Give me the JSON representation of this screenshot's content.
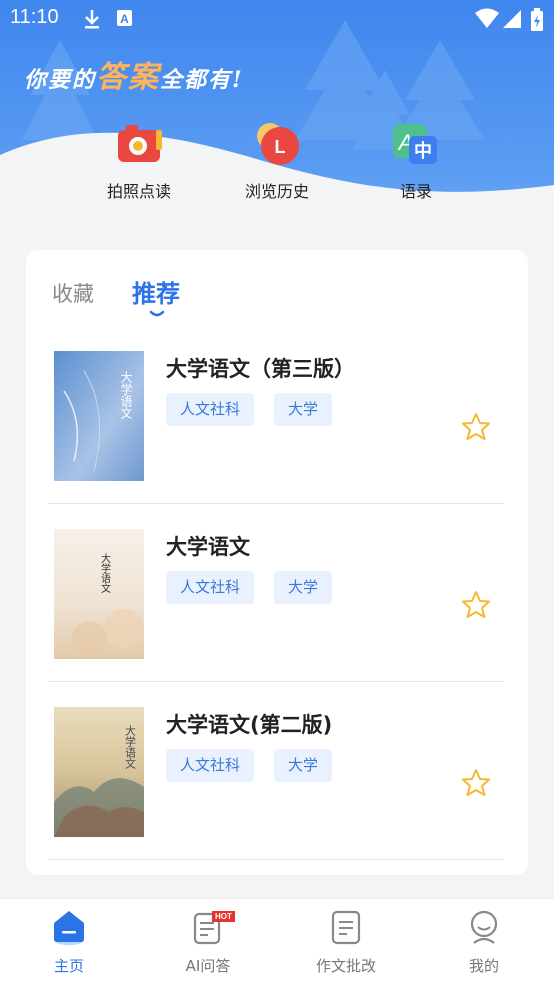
{
  "status_bar": {
    "time": "11:10"
  },
  "hero": {
    "slogan_prefix": "你要的",
    "slogan_highlight": "答案",
    "slogan_suffix": "全都有!",
    "quick_actions": [
      {
        "label": "拍照点读",
        "icon": "camera-icon"
      },
      {
        "label": "浏览历史",
        "icon": "history-icon"
      },
      {
        "label": "语录",
        "icon": "quotes-icon"
      }
    ]
  },
  "tabs": {
    "favorites": "收藏",
    "recommend": "推荐",
    "active": "推荐"
  },
  "books": [
    {
      "title": "大学语文（第三版）",
      "tags": [
        "人文社科",
        "大学"
      ]
    },
    {
      "title": "大学语文",
      "tags": [
        "人文社科",
        "大学"
      ]
    },
    {
      "title": "大学语文(第二版)",
      "tags": [
        "人文社科",
        "大学"
      ]
    }
  ],
  "bottom_nav": {
    "items": [
      {
        "label": "主页",
        "icon": "home-icon",
        "active": true
      },
      {
        "label": "AI问答",
        "icon": "ai-qa-icon",
        "badge": "HOT"
      },
      {
        "label": "作文批改",
        "icon": "essay-icon"
      },
      {
        "label": "我的",
        "icon": "profile-icon"
      }
    ]
  },
  "colors": {
    "primary": "#2b74e8",
    "tag_bg": "#e8f1fd",
    "star": "#f5b82e",
    "hot": "#e8332c"
  }
}
